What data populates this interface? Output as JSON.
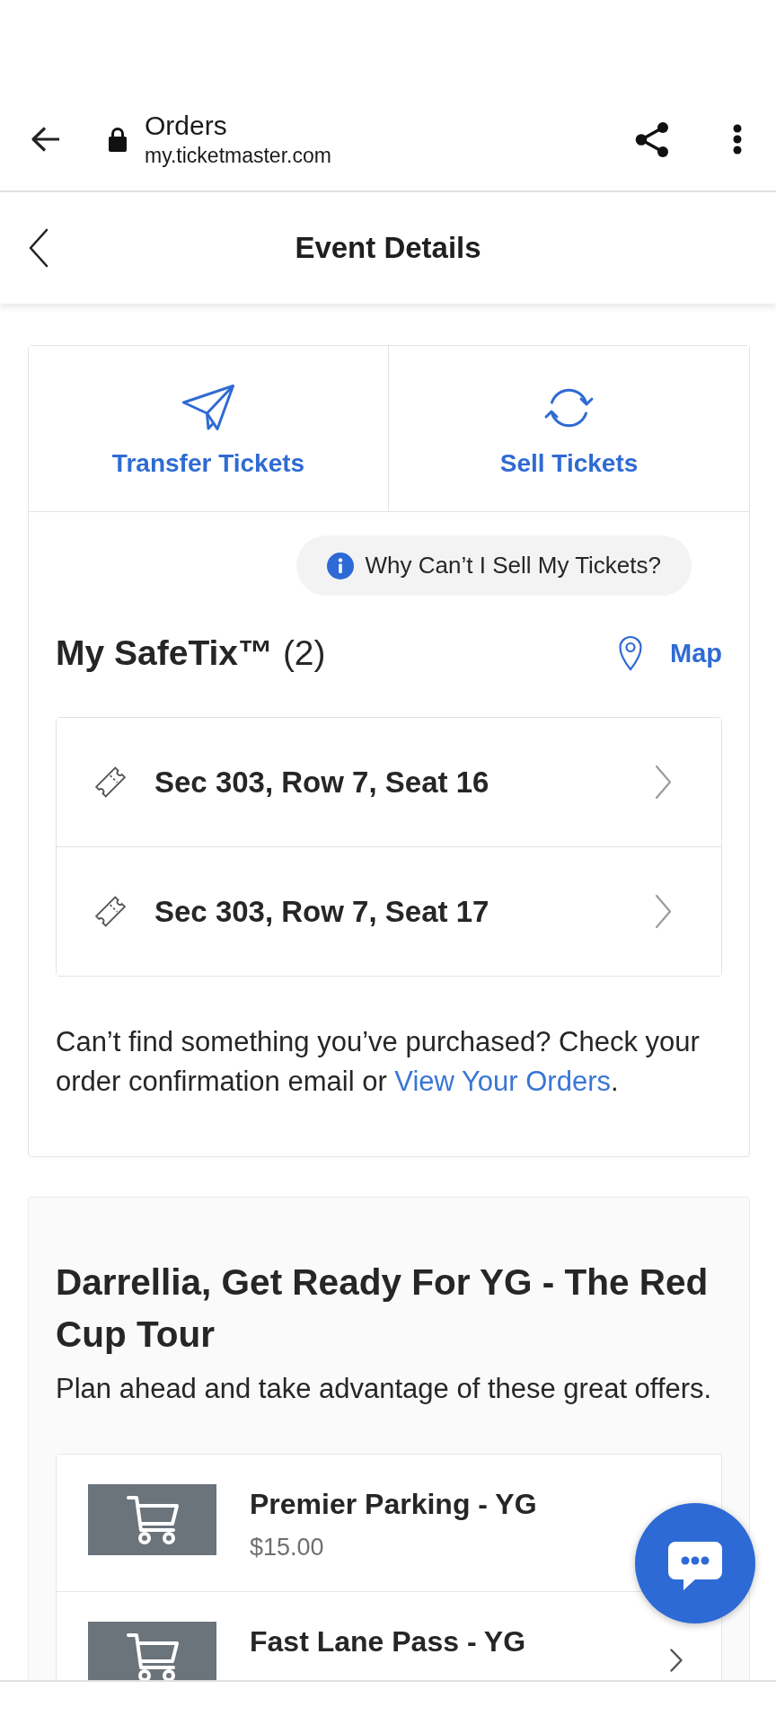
{
  "browser_bar": {
    "title": "Orders",
    "url": "my.ticketmaster.com"
  },
  "header": {
    "title": "Event Details"
  },
  "actions": [
    {
      "kind": "transfer",
      "label": "Transfer Tickets"
    },
    {
      "kind": "sell",
      "label": "Sell Tickets"
    }
  ],
  "info_button": {
    "label": "Why Can’t I Sell My Tickets?"
  },
  "tickets_section": {
    "title": "**My SafeTix™** (2)",
    "map_link": "Map",
    "tickets": [
      {
        "label": "Sec 303, Row 7, Seat 16"
      },
      {
        "label": "Sec 303, Row 7, Seat 17"
      }
    ],
    "help_text": {
      "before": "Can’t find something you’ve purchased? Check your order confirmation email or",
      "link": "View Your Orders",
      "after": "."
    }
  },
  "offers_section": {
    "title": "Darrellia, Get Ready For YG - The Red Cup Tour",
    "subtitle": "Plan ahead and take advantage of these great offers.",
    "offers": [
      {
        "title": "Premier Parking - YG",
        "price": "$15.00",
        "chevron": false
      },
      {
        "title": "Fast Lane Pass - YG",
        "chevron": true
      }
    ]
  }
}
